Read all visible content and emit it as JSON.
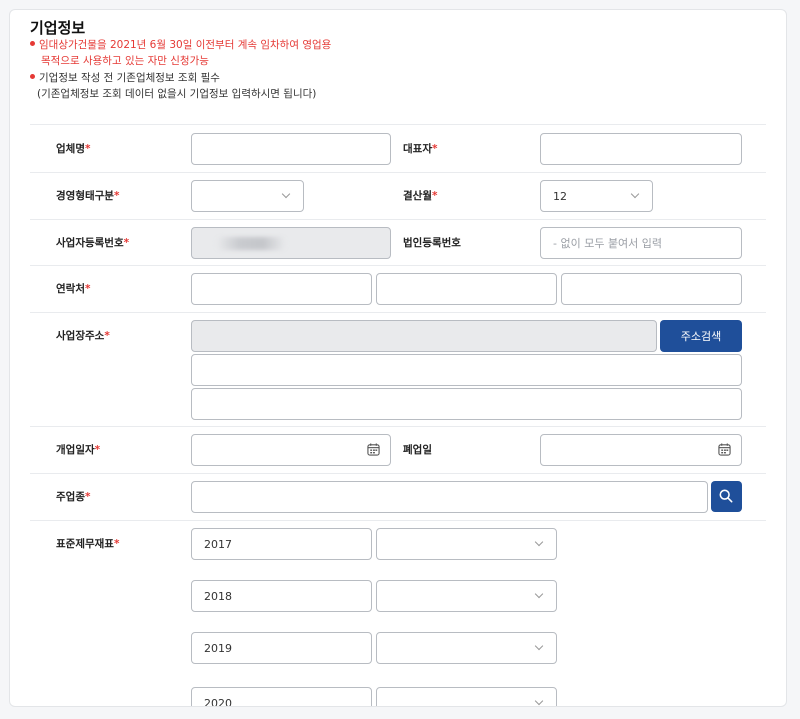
{
  "section": {
    "title": "기업정보",
    "notice1_line1": "임대상가건물을 2021년 6월 30일 이전부터 계속 임차하여 영업용",
    "notice1_line2": "목적으로 사용하고 있는 자만 신청가능",
    "notice2_line1": "기업정보 작성 전 기존업체정보 조회 필수",
    "notice2_line2": "(기존업체정보 조회 데이터 없을시 기업정보 입력하시면 됩니다)"
  },
  "colors": {
    "accent": "#1f4f9a",
    "required": "#e53935"
  },
  "required_mark": "*",
  "fields": {
    "company_name": {
      "label": "업체명",
      "value": ""
    },
    "ceo": {
      "label": "대표자",
      "value": ""
    },
    "business_type": {
      "label": "경영형태구분",
      "value": ""
    },
    "settlement_month": {
      "label": "결산월",
      "value": "12"
    },
    "business_reg_no": {
      "label": "사업자등록번호"
    },
    "corp_reg_no": {
      "label": "법인등록번호",
      "placeholder": "- 없이 모두 붙여서 입력"
    },
    "contact": {
      "label": "연락처",
      "values": [
        "",
        "",
        ""
      ]
    },
    "address": {
      "label": "사업장주소",
      "search_button": "주소검색",
      "line1": "",
      "line2": ""
    },
    "open_date": {
      "label": "개업일자",
      "value": ""
    },
    "close_date": {
      "label": "폐업일",
      "value": ""
    },
    "main_industry": {
      "label": "주업종",
      "value": ""
    },
    "financial_statements": {
      "label": "표준제무재표",
      "years": [
        "2017",
        "2018",
        "2019",
        "2020"
      ]
    }
  },
  "icons": {
    "calendar": "calendar-icon",
    "search": "search-icon",
    "chevron": "chevron-down-icon"
  }
}
